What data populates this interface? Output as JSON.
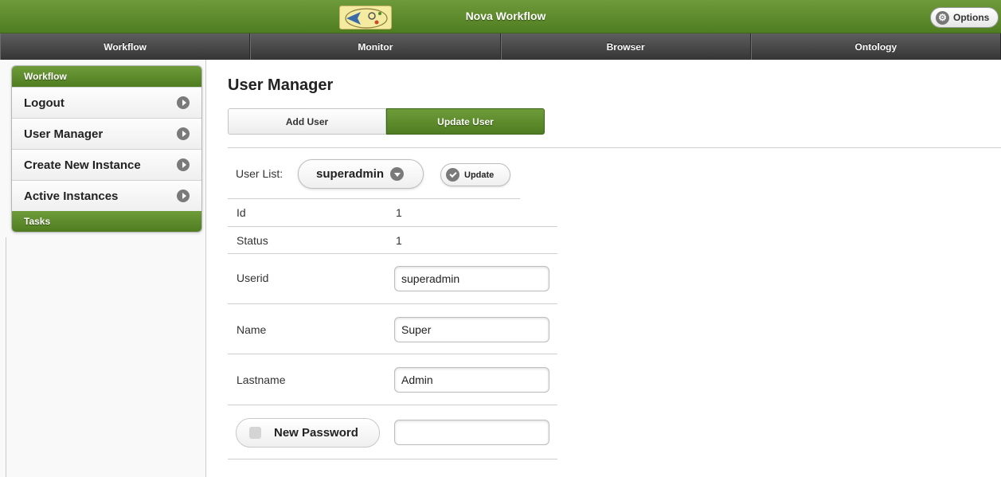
{
  "header": {
    "title": "Nova Workflow",
    "options_label": "Options"
  },
  "navbar": {
    "items": [
      "Workflow",
      "Monitor",
      "Browser",
      "Ontology"
    ]
  },
  "sidebar": {
    "section_workflow": "Workflow",
    "items": [
      {
        "label": "Logout"
      },
      {
        "label": "User Manager"
      },
      {
        "label": "Create New Instance"
      },
      {
        "label": "Active Instances"
      }
    ],
    "section_tasks": "Tasks"
  },
  "main": {
    "title": "User Manager",
    "tabs": {
      "add": "Add User",
      "update": "Update User",
      "active": "update"
    },
    "user_list": {
      "label": "User List:",
      "selected": "superadmin",
      "update_label": "Update"
    },
    "fields": {
      "id_label": "Id",
      "id_value": "1",
      "status_label": "Status",
      "status_value": "1",
      "userid_label": "Userid",
      "userid_value": "superadmin",
      "name_label": "Name",
      "name_value": "Super",
      "lastname_label": "Lastname",
      "lastname_value": "Admin",
      "new_password_label": "New Password",
      "new_password_value": ""
    }
  },
  "colors": {
    "accent_green": "#5a8a2a",
    "nav_dark": "#3a3a3a"
  }
}
